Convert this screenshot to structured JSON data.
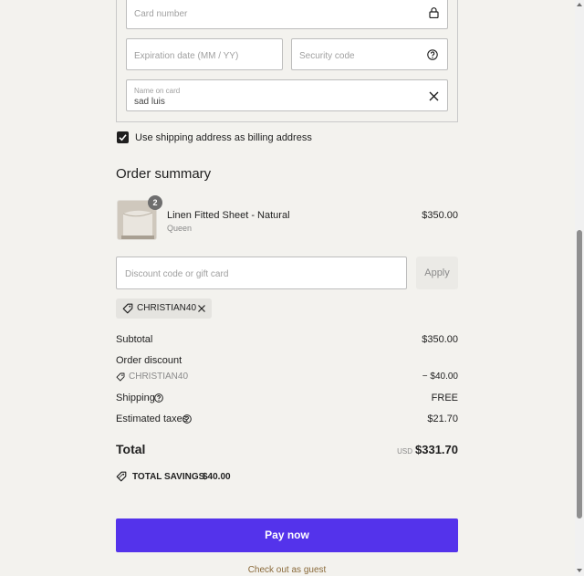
{
  "payment": {
    "card_number_placeholder": "Card number",
    "expiration_placeholder": "Expiration date (MM / YY)",
    "security_code_placeholder": "Security code",
    "name_on_card_label": "Name on card",
    "name_on_card_value": "sad luis"
  },
  "billing": {
    "checkbox_label": "Use shipping address as billing address",
    "checked": true
  },
  "summary": {
    "title": "Order summary",
    "item": {
      "name": "Linen Fitted Sheet - Natural",
      "variant": "Queen",
      "price": "$350.00",
      "quantity": "2"
    },
    "discount_placeholder": "Discount code or gift card",
    "apply_label": "Apply",
    "applied_code": "CHRISTIAN40",
    "subtotal_label": "Subtotal",
    "subtotal_value": "$350.00",
    "order_discount_label": "Order discount",
    "discount_code": "CHRISTIAN40",
    "discount_value": "− $40.00",
    "shipping_label": "Shipping",
    "shipping_value": "FREE",
    "taxes_label": "Estimated taxes",
    "taxes_value": "$21.70",
    "total_label": "Total",
    "currency": "USD",
    "total_value": "$331.70",
    "savings_label": "TOTAL SAVINGS",
    "savings_value": "$40.00"
  },
  "actions": {
    "pay_now": "Pay now",
    "guest_checkout": "Check out as guest"
  },
  "colors": {
    "background": "#f3f2ee",
    "pay_button": "#5433eb"
  }
}
